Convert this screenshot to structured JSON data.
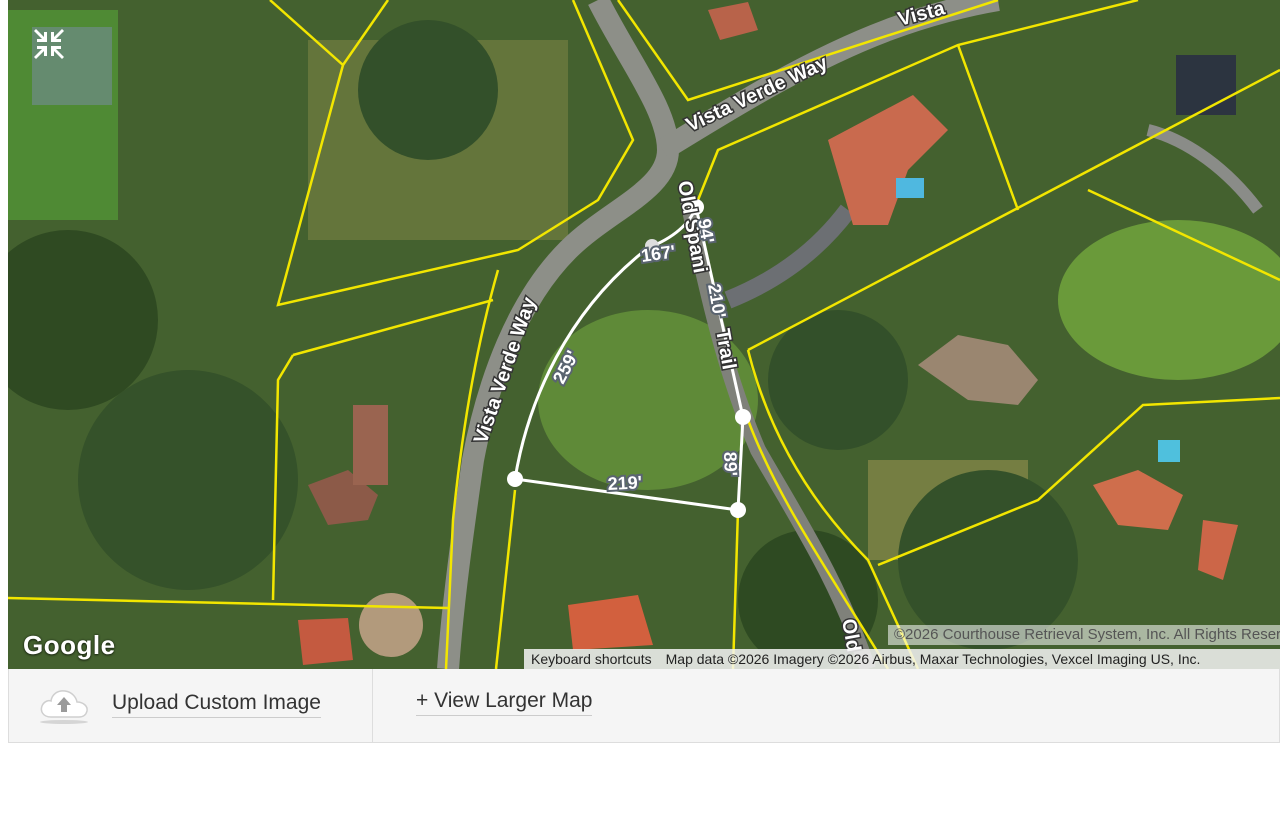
{
  "map": {
    "collapse_icon": "collapse-arrows-icon",
    "logo": "Google",
    "copyright": "©2026 Courthouse Retrieval System, Inc. All Rights Reserved",
    "attribution": {
      "keyboard_shortcuts": "Keyboard shortcuts",
      "map_data": "Map data ©2026 Imagery ©2026 Airbus, Maxar Technologies, Vexcel Imaging US, Inc."
    },
    "street_labels": {
      "vista_verde_top": "Vista Verde Way",
      "vista_verde_top_partial": "Vista",
      "vista_verde_left": "Vista Verde Way",
      "old_spanish_trail": "Old Spani",
      "old_spanish_trail_suffix": "Trail",
      "old_bottom": "Old"
    },
    "dimensions": {
      "north": "167'",
      "northeast": "94'",
      "east_upper": "210'",
      "west": "259'",
      "south": "219'",
      "east_lower": "89'"
    },
    "colors": {
      "parcel_lines": "#f2e600",
      "lot_outline": "#ffffff"
    }
  },
  "toolbar": {
    "upload_icon": "cloud-upload-icon",
    "upload_label": "Upload Custom Image",
    "larger_map_label": "+ View Larger Map"
  }
}
